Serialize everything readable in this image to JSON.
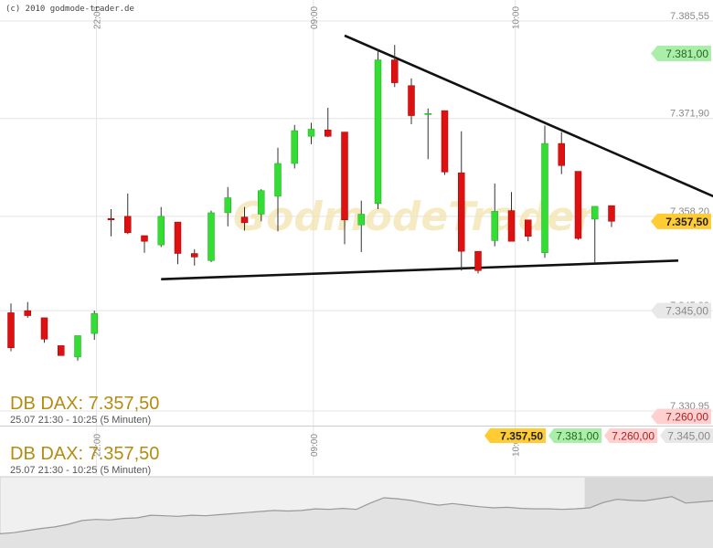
{
  "copyright": "(c) 2010 godmode-trader.de",
  "watermark": "GodmodeTrader",
  "colors": {
    "up": "#33dd33",
    "down": "#dd1111",
    "trendline": "#111111",
    "title": "#b58b10",
    "current_tag": "#ffcc33",
    "high_tag": "#aaeeaa",
    "low_tag": "#ffd0d0",
    "ref_tag": "#e8e8e8"
  },
  "chart_data": {
    "type": "candlestick",
    "title": "DB DAX: 7.357,50",
    "subtitle": "25.07 21:30 - 10:25 (5 Minuten)",
    "ylim": [
      7328.9,
      7388.1
    ],
    "y_ticks": [
      "7.385,55",
      "7.371,90",
      "7.358,20",
      "7.345,00",
      "7.330,95"
    ],
    "x_ticks": [
      "22:00",
      "09:00",
      "10:00"
    ],
    "price_tags": [
      {
        "label": "7.381,00",
        "value": 7381.0,
        "kind": "high"
      },
      {
        "label": "7.357,50",
        "value": 7357.5,
        "kind": "current"
      },
      {
        "label": "7.345,00",
        "value": 7345.0,
        "kind": "ref"
      },
      {
        "label": "7.260,00",
        "value": 7260.0,
        "kind": "low"
      }
    ],
    "candles": [
      {
        "open": 7344.7,
        "high": 7346.0,
        "low": 7339.3,
        "close": 7339.8
      },
      {
        "open": 7345.0,
        "high": 7346.2,
        "low": 7344.0,
        "close": 7344.3
      },
      {
        "open": 7344.0,
        "high": 7344.0,
        "low": 7340.5,
        "close": 7341.0
      },
      {
        "open": 7340.1,
        "high": 7340.1,
        "low": 7338.7,
        "close": 7338.7
      },
      {
        "open": 7338.5,
        "high": 7341.5,
        "low": 7338.0,
        "close": 7341.5
      },
      {
        "open": 7341.8,
        "high": 7345.0,
        "low": 7340.9,
        "close": 7344.6
      },
      {
        "open": 7357.9,
        "high": 7359.2,
        "low": 7355.4,
        "close": 7357.7
      },
      {
        "open": 7358.2,
        "high": 7361.4,
        "low": 7355.7,
        "close": 7355.9
      },
      {
        "open": 7355.5,
        "high": 7355.5,
        "low": 7353.1,
        "close": 7354.7
      },
      {
        "open": 7354.2,
        "high": 7359.5,
        "low": 7353.9,
        "close": 7358.2
      },
      {
        "open": 7357.4,
        "high": 7357.4,
        "low": 7351.5,
        "close": 7353.0
      },
      {
        "open": 7353.0,
        "high": 7353.6,
        "low": 7351.3,
        "close": 7352.5
      },
      {
        "open": 7352.0,
        "high": 7359.0,
        "low": 7351.8,
        "close": 7358.7
      },
      {
        "open": 7358.7,
        "high": 7362.3,
        "low": 7356.8,
        "close": 7360.8
      },
      {
        "open": 7358.1,
        "high": 7359.5,
        "low": 7356.2,
        "close": 7357.3
      },
      {
        "open": 7358.5,
        "high": 7362.0,
        "low": 7357.5,
        "close": 7361.8
      },
      {
        "open": 7361.0,
        "high": 7367.8,
        "low": 7356.1,
        "close": 7365.6
      },
      {
        "open": 7365.6,
        "high": 7371.0,
        "low": 7364.9,
        "close": 7370.2
      },
      {
        "open": 7369.4,
        "high": 7371.3,
        "low": 7368.3,
        "close": 7370.4
      },
      {
        "open": 7370.3,
        "high": 7373.4,
        "low": 7369.3,
        "close": 7369.4
      },
      {
        "open": 7370.0,
        "high": 7370.0,
        "low": 7354.3,
        "close": 7357.7
      },
      {
        "open": 7357.0,
        "high": 7360.4,
        "low": 7353.2,
        "close": 7358.5
      },
      {
        "open": 7360.0,
        "high": 7381.6,
        "low": 7359.2,
        "close": 7380.1
      },
      {
        "open": 7380.1,
        "high": 7382.2,
        "low": 7376.3,
        "close": 7376.9
      },
      {
        "open": 7376.5,
        "high": 7377.5,
        "low": 7371.1,
        "close": 7372.3
      },
      {
        "open": 7372.5,
        "high": 7373.3,
        "low": 7366.2,
        "close": 7372.6
      },
      {
        "open": 7373.0,
        "high": 7373.0,
        "low": 7364.0,
        "close": 7364.4
      },
      {
        "open": 7364.3,
        "high": 7370.1,
        "low": 7350.6,
        "close": 7353.3
      },
      {
        "open": 7353.3,
        "high": 7353.3,
        "low": 7350.2,
        "close": 7350.6
      },
      {
        "open": 7354.8,
        "high": 7362.8,
        "low": 7354.0,
        "close": 7358.9
      },
      {
        "open": 7359.0,
        "high": 7361.6,
        "low": 7354.7,
        "close": 7354.7
      },
      {
        "open": 7357.7,
        "high": 7357.7,
        "low": 7354.7,
        "close": 7355.4
      },
      {
        "open": 7353.1,
        "high": 7370.9,
        "low": 7352.4,
        "close": 7368.4
      },
      {
        "open": 7368.4,
        "high": 7370.0,
        "low": 7364.1,
        "close": 7365.3
      },
      {
        "open": 7364.5,
        "high": 7364.5,
        "low": 7354.9,
        "close": 7355.1
      },
      {
        "open": 7357.8,
        "high": 7359.6,
        "low": 7351.6,
        "close": 7359.6
      },
      {
        "open": 7359.7,
        "high": 7359.7,
        "low": 7356.7,
        "close": 7357.5
      }
    ],
    "trendlines": [
      {
        "name": "upper",
        "from": {
          "candle": 20,
          "value": 7383.5
        },
        "to": {
          "candle": 42.4,
          "value": 7360.7
        }
      },
      {
        "name": "lower",
        "from": {
          "candle": 9,
          "value": 7349.4
        },
        "to": {
          "candle": 40,
          "value": 7352.0
        }
      }
    ]
  },
  "lower_panel": {
    "title": "DB DAX: 7.357,50",
    "subtitle": "25.07 21:30 - 10:25 (5 Minuten)",
    "tags": [
      {
        "label": "7.357,50",
        "kind": "current"
      },
      {
        "label": "7.381,00",
        "kind": "high"
      },
      {
        "label": "7.260,00",
        "kind": "low"
      },
      {
        "label": "7.345,00",
        "kind": "ref"
      }
    ]
  },
  "navigator": {
    "overview_values": [
      0.2,
      0.22,
      0.26,
      0.3,
      0.33,
      0.38,
      0.45,
      0.47,
      0.46,
      0.49,
      0.5,
      0.55,
      0.54,
      0.53,
      0.55,
      0.54,
      0.56,
      0.58,
      0.6,
      0.62,
      0.64,
      0.63,
      0.64,
      0.67,
      0.66,
      0.68,
      0.66,
      0.78,
      0.88,
      0.86,
      0.83,
      0.78,
      0.74,
      0.77,
      0.74,
      0.71,
      0.69,
      0.7,
      0.68,
      0.67,
      0.67,
      0.66,
      0.67,
      0.69,
      0.79,
      0.85,
      0.83,
      0.82,
      0.86,
      0.9,
      0.78,
      0.8,
      0.82
    ],
    "selection_start": 0.82
  }
}
